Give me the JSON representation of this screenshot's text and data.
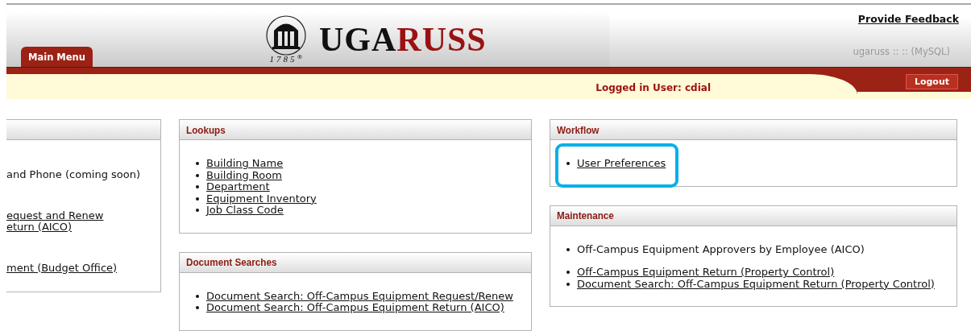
{
  "header": {
    "tab": {
      "label": "Main Menu",
      "selected": true
    },
    "logo": {
      "left": "UGA",
      "right": "RUSS",
      "year": "1785",
      "mark": "®"
    },
    "feedback_link": "Provide Feedback",
    "db_info": "ugaruss :: :: (MySQL)",
    "logged_in": "Logged in User: cdial",
    "logout": "Logout"
  },
  "columns": [
    [
      {
        "cut_left": true,
        "groups": [
          [
            {
              "text": "and Phone (coming soon)",
              "kind": "text"
            }
          ],
          [
            {
              "text": "equest and Renew",
              "kind": "link"
            },
            {
              "text": "eturn (AICO)",
              "kind": "link"
            }
          ],
          [
            {
              "text": "ment (Budget Office)",
              "kind": "link"
            }
          ]
        ]
      }
    ],
    [
      {
        "title": "Lookups",
        "groups": [
          [
            {
              "text": "Building Name",
              "kind": "link"
            },
            {
              "text": "Building Room",
              "kind": "link"
            },
            {
              "text": "Department",
              "kind": "link"
            },
            {
              "text": "Equipment Inventory",
              "kind": "link"
            },
            {
              "text": "Job Class Code",
              "kind": "link"
            }
          ]
        ]
      },
      {
        "title": "Document Searches",
        "groups": [
          [
            {
              "text": "Document Search: Off-Campus Equipment Request/Renew",
              "kind": "link"
            },
            {
              "text": "Document Search: Off-Campus Equipment Return (AICO)",
              "kind": "link"
            }
          ]
        ]
      }
    ],
    [
      {
        "title": "Workflow",
        "groups": [
          [
            {
              "text": "User Preferences",
              "kind": "link",
              "highlighted": true
            }
          ]
        ]
      },
      {
        "title": "Maintenance",
        "groups": [
          [
            {
              "text": "Off-Campus Equipment Approvers by Employee (AICO)",
              "kind": "text"
            }
          ],
          [
            {
              "text": "Off-Campus Equipment Return (Property Control)",
              "kind": "link"
            },
            {
              "text": "Document Search: Off-Campus Equipment Return (Property Control)",
              "kind": "link"
            }
          ]
        ]
      }
    ]
  ]
}
